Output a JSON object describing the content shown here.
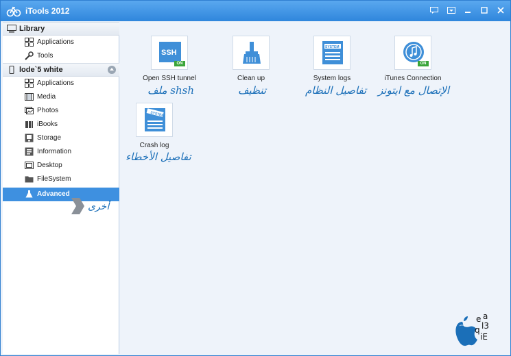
{
  "window": {
    "title": "iTools 2012"
  },
  "sidebar": {
    "library": {
      "label": "Library",
      "items": [
        {
          "label": "Applications",
          "icon": "grid-icon"
        },
        {
          "label": "Tools",
          "icon": "wrench-icon"
        }
      ]
    },
    "device": {
      "label": "lode`5 white",
      "items": [
        {
          "label": "Applications",
          "icon": "grid-icon"
        },
        {
          "label": "Media",
          "icon": "film-icon"
        },
        {
          "label": "Photos",
          "icon": "photo-icon"
        },
        {
          "label": "iBooks",
          "icon": "book-icon"
        },
        {
          "label": "Storage",
          "icon": "storage-icon"
        },
        {
          "label": "Information",
          "icon": "info-icon"
        },
        {
          "label": "Desktop",
          "icon": "desktop-icon"
        },
        {
          "label": "FileSystem",
          "icon": "folder-icon"
        },
        {
          "label": "Advanced",
          "icon": "flask-icon",
          "active": true
        }
      ]
    },
    "advanced_annotation": "أخرى"
  },
  "tools": [
    {
      "label": "Open SSH tunnel",
      "annotation": "ملف shsh",
      "badge": "ON",
      "tile_text": "SSH"
    },
    {
      "label": "Clean up",
      "annotation": "تنظيف"
    },
    {
      "label": "System logs",
      "annotation": "تفاصيل النظام",
      "tile_text": "SYSTEM"
    },
    {
      "label": "iTunes Connection",
      "annotation": "الإتصال مع ايتونز",
      "badge": "ON"
    },
    {
      "label": "Crash log",
      "annotation": "تفاصيل الأخطاء",
      "tile_text": "SYSTEM"
    }
  ],
  "colors": {
    "titlebar": "#2f86dc",
    "accent": "#3e90e0",
    "annotation": "#1b6fb8"
  }
}
